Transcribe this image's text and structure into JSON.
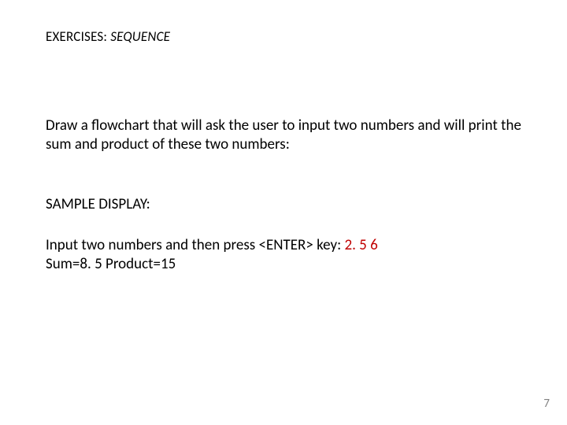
{
  "heading": {
    "prefix": "EXERCISES: ",
    "italic": "SEQUENCE"
  },
  "instruction": "Draw a flowchart that will ask the user to input two numbers and will print the sum and product of these two numbers:",
  "sample_label": "SAMPLE DISPLAY:",
  "io": {
    "prompt": "Input two numbers and then press <ENTER> key: ",
    "user_input": "2. 5 6",
    "result": "Sum=8. 5 Product=15"
  },
  "page_number": "7"
}
